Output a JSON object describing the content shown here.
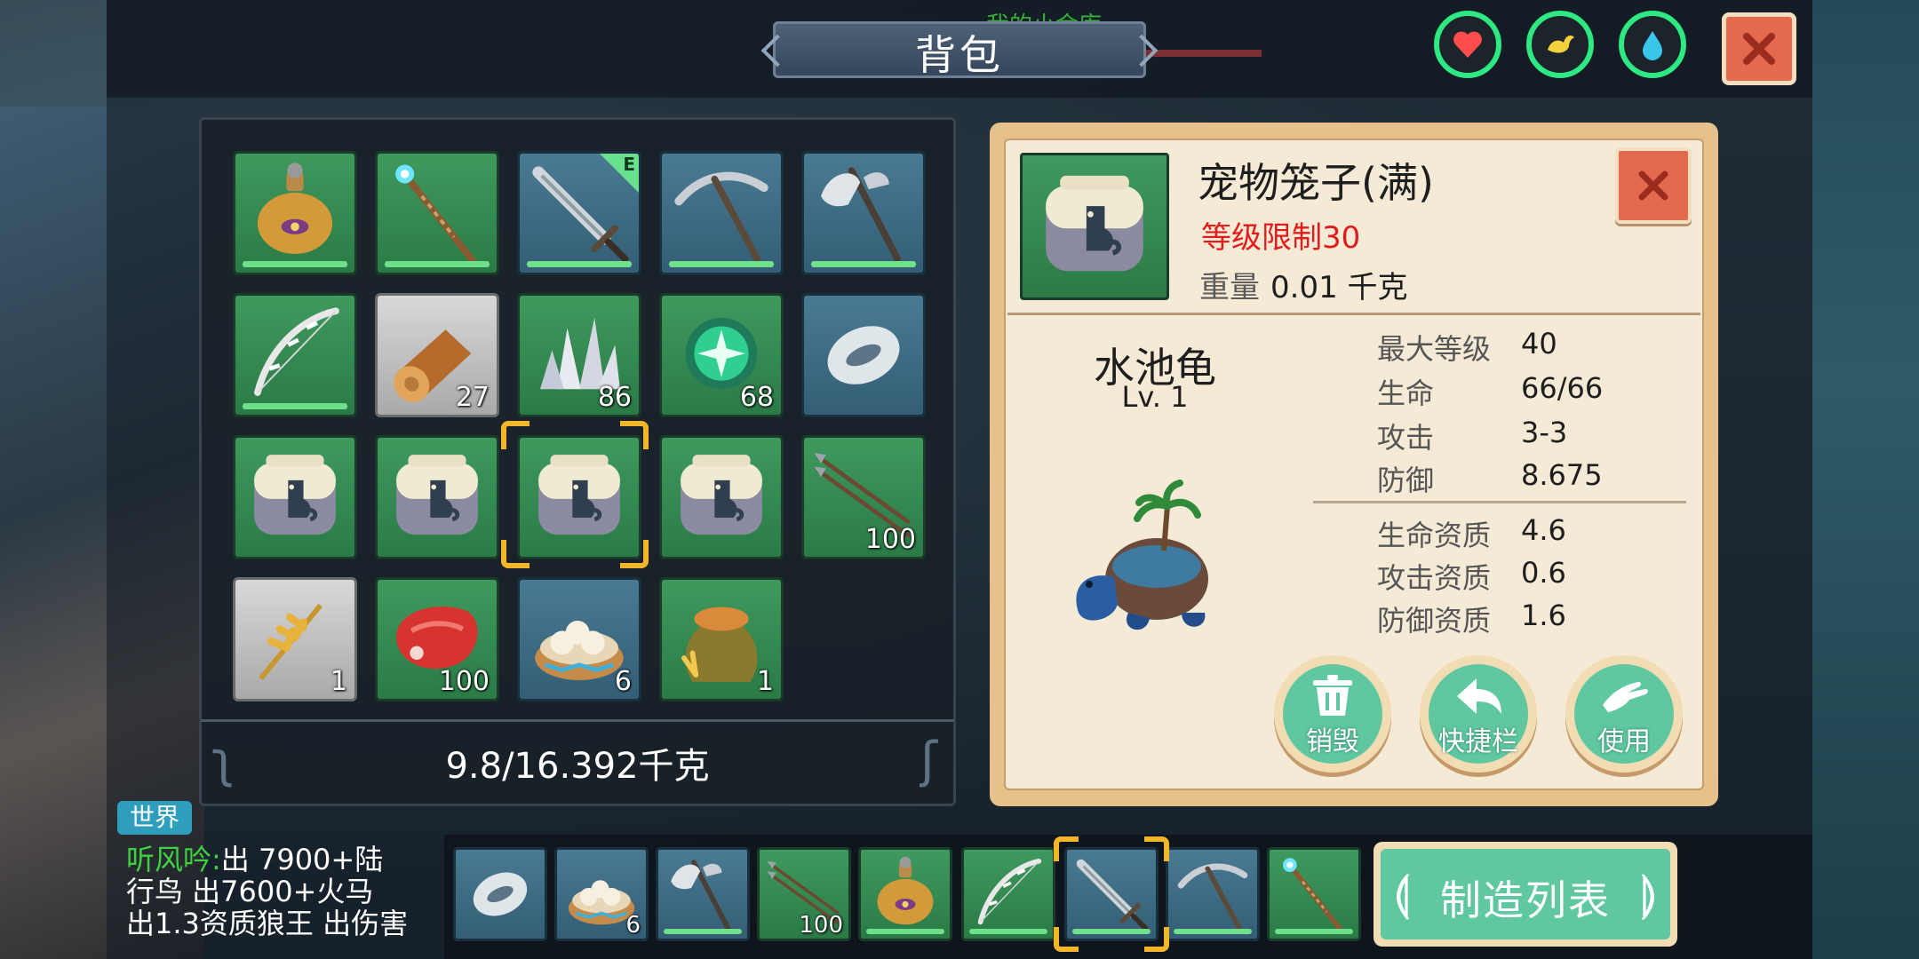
{
  "header": {
    "title": "背包",
    "ghost_text": "我的小金库",
    "stat_icons": [
      "heart-icon",
      "stamina-icon",
      "water-drop-icon"
    ],
    "colors": {
      "ring": "#2ee882",
      "heart": "#ff4d4d",
      "stamina": "#f5d23b",
      "water": "#39c6e8"
    }
  },
  "inventory": {
    "slots": [
      {
        "icon": "water-flask-icon",
        "bg": "green",
        "count": "",
        "durability": true,
        "equipped": false
      },
      {
        "icon": "magic-staff-icon",
        "bg": "green",
        "count": "",
        "durability": true,
        "equipped": false
      },
      {
        "icon": "sword-icon",
        "bg": "blue",
        "count": "",
        "durability": true,
        "equipped": true
      },
      {
        "icon": "pickaxe-icon",
        "bg": "blue",
        "count": "",
        "durability": true,
        "equipped": false
      },
      {
        "icon": "battle-axe-icon",
        "bg": "blue",
        "count": "",
        "durability": true,
        "equipped": false
      },
      {
        "icon": "bow-icon",
        "bg": "green",
        "count": "",
        "durability": true,
        "equipped": false
      },
      {
        "icon": "wood-log-icon",
        "bg": "gray",
        "count": "27",
        "durability": false,
        "equipped": false
      },
      {
        "icon": "crystal-icon",
        "bg": "green",
        "count": "86",
        "durability": false,
        "equipped": false
      },
      {
        "icon": "green-orb-icon",
        "bg": "green",
        "count": "68",
        "durability": false,
        "equipped": false
      },
      {
        "icon": "shield-stone-icon",
        "bg": "blue",
        "count": "",
        "durability": false,
        "equipped": false
      },
      {
        "icon": "pet-cage-icon",
        "bg": "green",
        "count": "",
        "durability": false,
        "equipped": false
      },
      {
        "icon": "pet-cage-icon",
        "bg": "green",
        "count": "",
        "durability": false,
        "equipped": false
      },
      {
        "icon": "pet-cage-icon",
        "bg": "green",
        "count": "",
        "durability": false,
        "equipped": false,
        "selected": true
      },
      {
        "icon": "pet-cage-icon",
        "bg": "green",
        "count": "",
        "durability": false,
        "equipped": false
      },
      {
        "icon": "arrows-icon",
        "bg": "green",
        "count": "100",
        "durability": false,
        "equipped": false
      },
      {
        "icon": "wheat-icon",
        "bg": "gray",
        "count": "1",
        "durability": false,
        "equipped": false
      },
      {
        "icon": "raw-meat-icon",
        "bg": "green",
        "count": "100",
        "durability": false,
        "equipped": false
      },
      {
        "icon": "steamed-buns-icon",
        "bg": "blue",
        "count": "6",
        "durability": false,
        "equipped": false
      },
      {
        "icon": "seed-bag-icon",
        "bg": "green",
        "count": "1",
        "durability": false,
        "equipped": false
      }
    ],
    "equipped_badge": "E",
    "weight_text": "9.8/16.392千克"
  },
  "detail": {
    "item_name": "宠物笼子(满)",
    "level_requirement": "等级限制30",
    "weight_label": "重量",
    "weight_value": "0.01 千克",
    "pet_name": "水池龟",
    "pet_level": "Lv. 1",
    "stats": [
      {
        "label": "最大等级",
        "value": "40"
      },
      {
        "label": "生命",
        "value": "66/66"
      },
      {
        "label": "攻击",
        "value": "3-3"
      },
      {
        "label": "防御",
        "value": "8.675"
      }
    ],
    "aptitudes": [
      {
        "label": "生命资质",
        "value": "4.6"
      },
      {
        "label": "攻击资质",
        "value": "0.6"
      },
      {
        "label": "防御资质",
        "value": "1.6"
      }
    ],
    "actions": [
      {
        "label": "销毁",
        "icon": "trash-icon"
      },
      {
        "label": "快捷栏",
        "icon": "arrow-back-icon"
      },
      {
        "label": "使用",
        "icon": "hand-icon"
      }
    ]
  },
  "chat": {
    "channel": "世界",
    "speaker": "听风吟",
    "separator": ":",
    "message_part1": "出 7900+陆",
    "message_part2": "行鸟  出7600+火马",
    "message_part3": "出1.3资质狼王 出伤害"
  },
  "hotbar": {
    "slots": [
      {
        "icon": "shield-stone-icon",
        "bg": "blue",
        "count": "",
        "durability": false
      },
      {
        "icon": "steamed-buns-icon",
        "bg": "blue",
        "count": "6",
        "durability": false
      },
      {
        "icon": "battle-axe-icon",
        "bg": "blue",
        "count": "",
        "durability": true
      },
      {
        "icon": "arrows-icon",
        "bg": "green",
        "count": "100",
        "durability": false
      },
      {
        "icon": "water-flask-icon",
        "bg": "green",
        "count": "",
        "durability": true
      },
      {
        "icon": "bow-icon",
        "bg": "green",
        "count": "",
        "durability": true
      },
      {
        "icon": "sword-icon",
        "bg": "blue",
        "count": "",
        "durability": true,
        "selected": true
      },
      {
        "icon": "pickaxe-icon",
        "bg": "blue",
        "count": "",
        "durability": true
      },
      {
        "icon": "magic-staff-icon",
        "bg": "green",
        "count": "",
        "durability": true
      }
    ],
    "craft_label": "制造列表"
  }
}
